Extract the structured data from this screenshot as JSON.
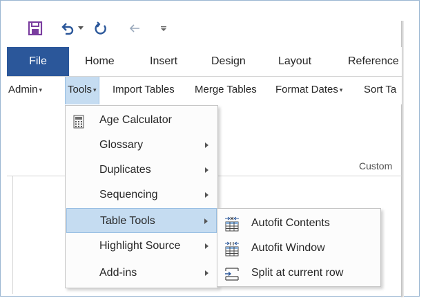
{
  "qat": {
    "save_icon": "save-icon",
    "undo_icon": "undo-icon",
    "undo_dropdown_icon": "chevron-down-icon",
    "redo_icon": "repeat-icon",
    "back_icon": "arrow-left-icon",
    "customize_icon": "customize-qat-icon"
  },
  "tabs": [
    {
      "label": "File"
    },
    {
      "label": "Home"
    },
    {
      "label": "Insert"
    },
    {
      "label": "Design"
    },
    {
      "label": "Layout"
    },
    {
      "label": "Reference"
    }
  ],
  "tools": [
    {
      "label": "Admin"
    },
    {
      "label": "Tools"
    },
    {
      "label": "Import Tables"
    },
    {
      "label": "Merge Tables"
    },
    {
      "label": "Format Dates"
    },
    {
      "label": "Sort Ta"
    }
  ],
  "group_label": "Custom",
  "tools_menu": [
    {
      "label": "Age Calculator",
      "icon": "calculator-icon"
    },
    {
      "label": "Glossary"
    },
    {
      "label": "Duplicates"
    },
    {
      "label": "Sequencing"
    },
    {
      "label": "Table Tools"
    },
    {
      "label": "Highlight Source"
    },
    {
      "label": "Add-ins"
    }
  ],
  "table_tools_menu": [
    {
      "label": "Autofit Contents",
      "icon": "autofit-contents-icon"
    },
    {
      "label": "Autofit Window",
      "icon": "autofit-window-icon"
    },
    {
      "label": "Split at current row",
      "icon": "split-table-icon"
    }
  ],
  "colors": {
    "accent": "#2b579a",
    "save_purple": "#7a3d9f",
    "menu_highlight": "#c5dcf1"
  }
}
